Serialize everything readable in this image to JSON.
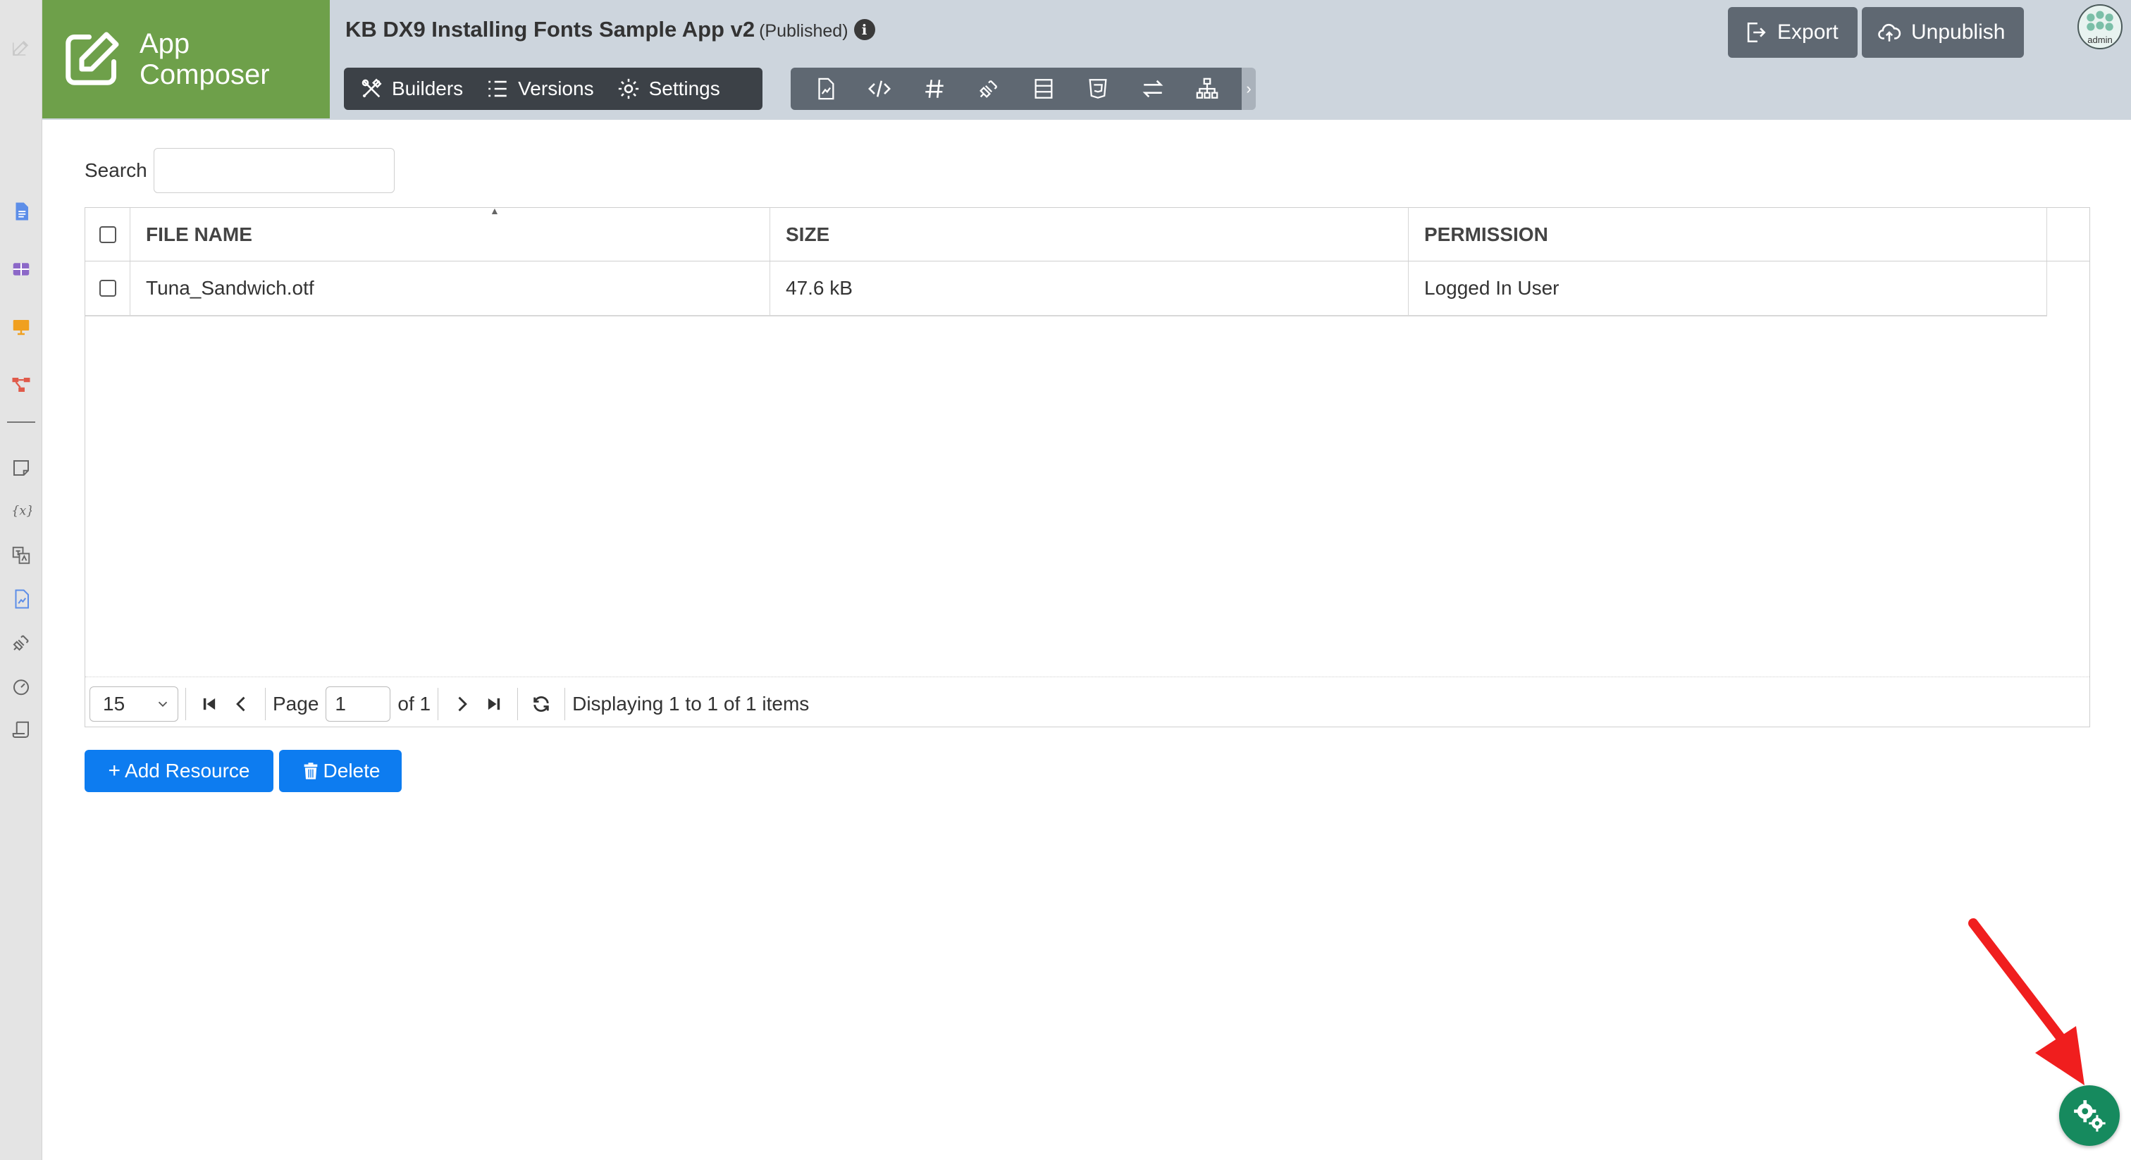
{
  "rail": {
    "items": [
      {
        "name": "edit-icon",
        "color": "#c9c9c9"
      },
      {
        "name": "document-icon",
        "color": "#5d8ee8"
      },
      {
        "name": "table-icon",
        "color": "#8c68c8"
      },
      {
        "name": "monitor-icon",
        "color": "#f0a020"
      },
      {
        "name": "workflow-icon",
        "color": "#e05a4a"
      },
      {
        "name": "note-icon",
        "color": "#666666"
      },
      {
        "name": "variable-icon",
        "color": "#666666"
      },
      {
        "name": "translate-icon",
        "color": "#666666"
      },
      {
        "name": "report-icon",
        "color": "#5d8ee8"
      },
      {
        "name": "plugin-icon",
        "color": "#666666"
      },
      {
        "name": "dashboard-icon",
        "color": "#666666"
      },
      {
        "name": "scroll-icon",
        "color": "#666666"
      }
    ]
  },
  "brand": {
    "line1": "App",
    "line2": "Composer"
  },
  "header": {
    "title": "KB DX9 Installing Fonts Sample App v2",
    "status": "(Published)",
    "info_glyph": "i",
    "export_label": "Export",
    "unpublish_label": "Unpublish",
    "avatar_label": "admin"
  },
  "nav": {
    "builders": "Builders",
    "versions": "Versions",
    "settings": "Settings"
  },
  "toolbar": {
    "icons": [
      "page-icon",
      "code-icon",
      "hash-icon",
      "plug-icon",
      "form-icon",
      "css-icon",
      "transfer-icon",
      "sitemap-icon"
    ],
    "scroll_glyph": "›"
  },
  "search": {
    "label": "Search",
    "value": ""
  },
  "table": {
    "columns": [
      "FILE NAME",
      "SIZE",
      "PERMISSION"
    ],
    "sort_glyph": "▲",
    "rows": [
      {
        "file_name": "Tuna_Sandwich.otf",
        "size": "47.6 kB",
        "permission": "Logged In User"
      }
    ]
  },
  "pager": {
    "page_size": "15",
    "page_label": "Page",
    "page_value": "1",
    "of_label": "of 1",
    "status": "Displaying 1 to 1 of 1 items"
  },
  "actions": {
    "add_glyph": "+",
    "add_label": "Add Resource",
    "delete_label": "Delete"
  },
  "colors": {
    "brand": "#6ea04a",
    "header_bg": "#cdd5dd",
    "primary": "#0d7cf0",
    "fab": "#168a5e",
    "annotation_arrow": "#f01e1e"
  }
}
